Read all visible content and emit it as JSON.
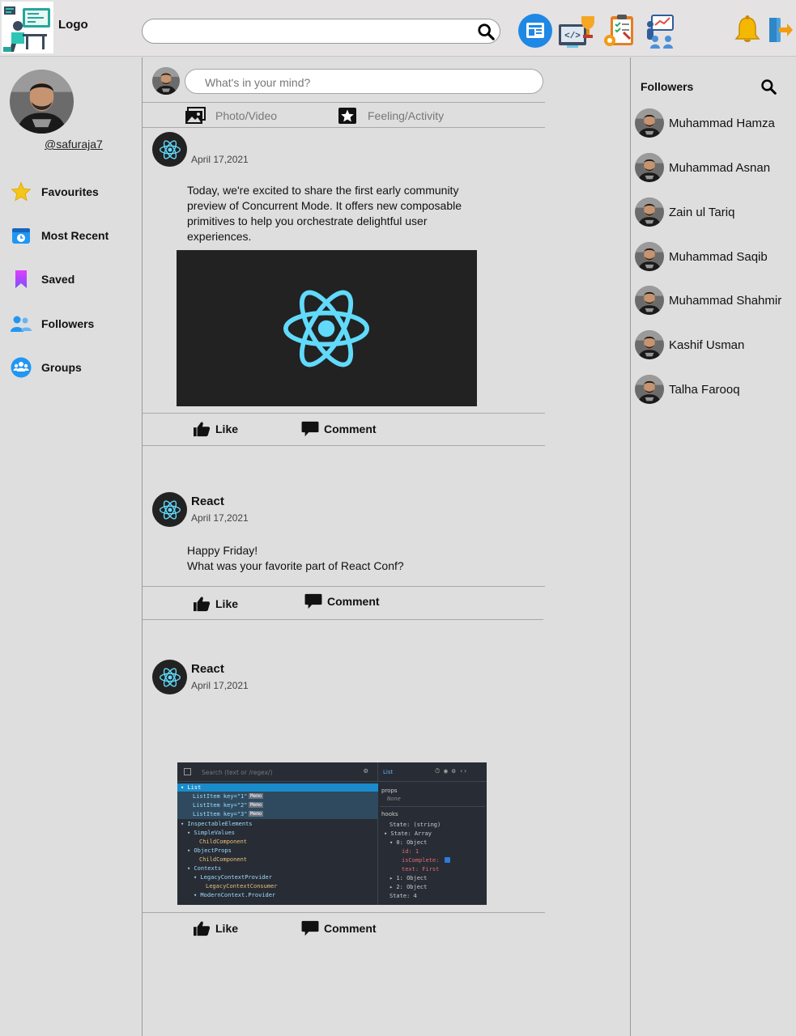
{
  "header": {
    "logo_text": "Logo",
    "search_placeholder": "",
    "icons": [
      "news-icon",
      "code-trophy-icon",
      "task-settings-icon",
      "team-board-icon",
      "notification-bell-icon",
      "logout-icon"
    ]
  },
  "sidebar": {
    "handle": "@safuraja7",
    "items": [
      {
        "label": "Favourites",
        "icon": "star-icon"
      },
      {
        "label": "Most Recent",
        "icon": "recent-icon"
      },
      {
        "label": "Saved",
        "icon": "bookmark-icon"
      },
      {
        "label": "Followers",
        "icon": "followers-icon"
      },
      {
        "label": "Groups",
        "icon": "groups-icon"
      }
    ]
  },
  "composer": {
    "placeholder": "What's in your mind?",
    "photo_label": "Photo/Video",
    "feeling_label": "Feeling/Activity"
  },
  "posts": [
    {
      "author": "",
      "date": "April 17,2021",
      "text": "Today, we're excited to share the first early community preview of Concurrent Mode. It offers new composable primitives to help you orchestrate delightful user experiences.",
      "like_label": "Like",
      "comment_label": "Comment"
    },
    {
      "author": "React",
      "date": "April 17,2021",
      "text_line1": "Happy Friday!",
      "text_line2": "What was your favorite part of React Conf?",
      "like_label": "Like",
      "comment_label": "Comment"
    },
    {
      "author": "React",
      "date": "April 17,2021",
      "like_label": "Like",
      "comment_label": "Comment",
      "devtools": {
        "search_placeholder": "Search (text or /regex/)",
        "panel_title": "List",
        "tree": [
          "▾ List",
          "ListItem key=\"1\"",
          "ListItem key=\"2\"",
          "ListItem key=\"3\"",
          "▾ InspectableElements",
          "▾ SimpleValues",
          "ChildComponent",
          "▾ ObjectProps",
          "ChildComponent",
          "▾ Contexts",
          "▾ LegacyContextProvider",
          "LegacyContextConsumer",
          "▾ ModernContext.Provider"
        ],
        "memo_badge": "Memo",
        "props_label": "props",
        "props_value": "None",
        "hooks_label": "hooks",
        "hooks": [
          "State: (string)",
          "▾ State: Array",
          "▾ 0: Object",
          "id: 1",
          "isComplete:",
          "text: First",
          "▸ 1: Object",
          "▸ 2: Object",
          "State: 4"
        ]
      }
    }
  ],
  "followers": {
    "title": "Followers",
    "list": [
      "Muhammad Hamza",
      "Muhammad Asnan",
      "Zain ul Tariq",
      "Muhammad Saqib",
      "Muhammad Shahmir",
      "Kashif Usman",
      "Talha Farooq"
    ]
  },
  "colors": {
    "react_blue": "#61dafb",
    "background": "#dedede",
    "header_bg": "#e4e2e3"
  }
}
